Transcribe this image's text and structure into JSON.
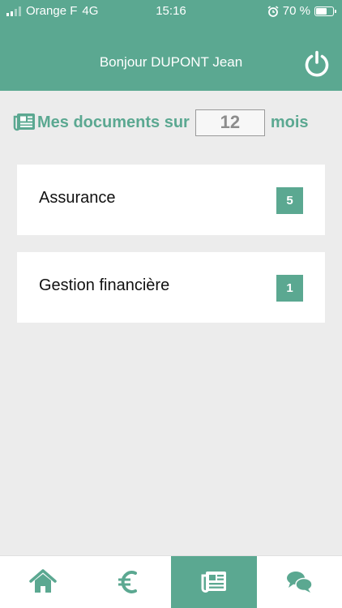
{
  "status_bar": {
    "carrier": "Orange F",
    "network": "4G",
    "time": "15:16",
    "battery_percent": "70 %",
    "battery_level": 0.7
  },
  "header": {
    "greeting": "Bonjour DUPONT Jean",
    "power_icon": "power-icon"
  },
  "documents": {
    "title_prefix": "Mes documents sur",
    "months_value": "12",
    "title_suffix": "mois"
  },
  "categories": [
    {
      "label": "Assurance",
      "count": "5"
    },
    {
      "label": "Gestion financière",
      "count": "1"
    }
  ],
  "bottom_nav": [
    {
      "icon": "home-icon",
      "active": false
    },
    {
      "icon": "euro-icon",
      "active": false
    },
    {
      "icon": "newspaper-icon",
      "active": true
    },
    {
      "icon": "chat-icon",
      "active": false
    }
  ],
  "colors": {
    "accent": "#5ba891",
    "background": "#ececec"
  }
}
